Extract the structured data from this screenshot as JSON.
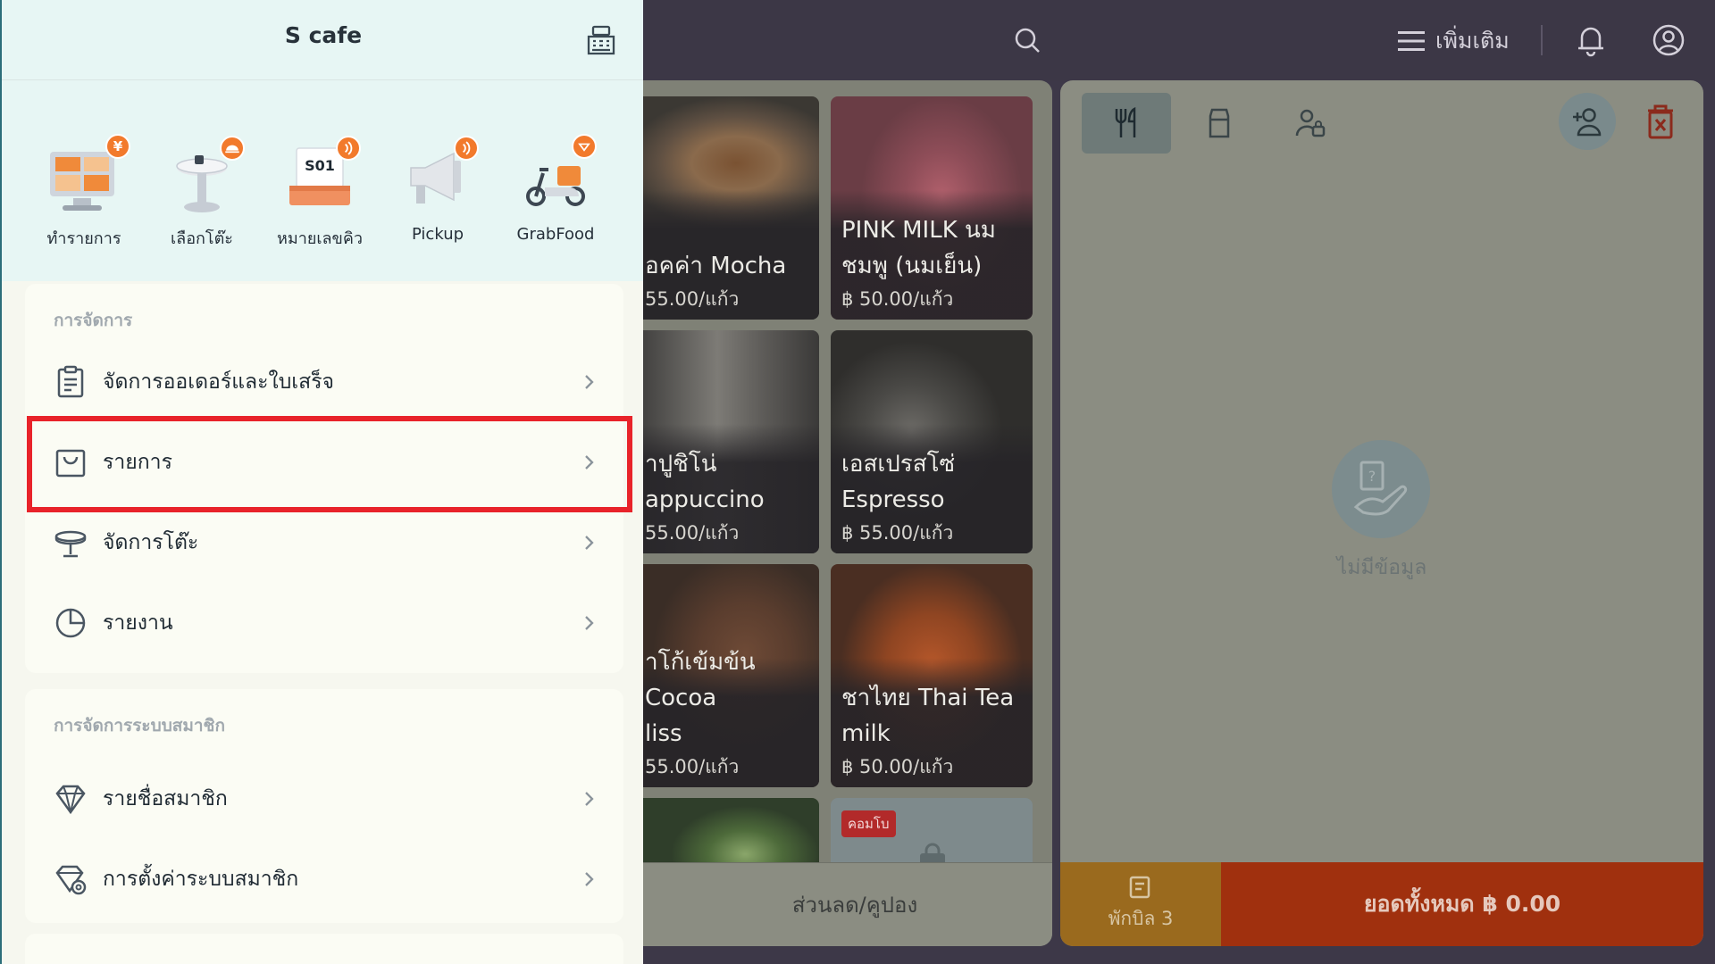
{
  "topbar": {
    "more_label": "เพิ่มเติม"
  },
  "drawer": {
    "title": "S cafe",
    "quick_actions": [
      {
        "label": "ทำรายการ",
        "badge": "¥"
      },
      {
        "label": "เลือกโต๊ะ"
      },
      {
        "label": "หมายเลขคิว",
        "code": "S01"
      },
      {
        "label": "Pickup"
      },
      {
        "label": "GrabFood"
      }
    ],
    "management": {
      "title": "การจัดการ",
      "items": [
        {
          "label": "จัดการออเดอร์และใบเสร็จ"
        },
        {
          "label": "รายการ"
        },
        {
          "label": "จัดการโต๊ะ"
        },
        {
          "label": "รายงาน"
        }
      ]
    },
    "membership": {
      "title": "การจัดการระบบสมาชิก",
      "items": [
        {
          "label": "รายชื่อสมาชิก"
        },
        {
          "label": "การตั้งค่าระบบสมาชิก"
        }
      ]
    }
  },
  "products": {
    "items": [
      {
        "name": "อคค่า Mocha",
        "price": "55.00/แก้ว"
      },
      {
        "name": "PINK MILK  นม\nชมพู (นมเย็น)",
        "price": "฿ 50.00/แก้ว"
      },
      {
        "name": "าปูชิโน่\nappuccino",
        "price": "55.00/แก้ว"
      },
      {
        "name": "เอสเปรสโซ่\nEspresso",
        "price": "฿ 55.00/แก้ว"
      },
      {
        "name": "าโก้เข้มข้น Cocoa\nliss",
        "price": "55.00/แก้ว"
      },
      {
        "name": "ชาไทย  Thai Tea\nmilk",
        "price": "฿ 50.00/แก้ว"
      }
    ],
    "combo_tag": "คอมโบ",
    "discount_label": "ส่วนลด/คูปอง"
  },
  "order": {
    "empty_text": "ไม่มีข้อมูล",
    "park_label": "พักบิล 3",
    "total_label": "ยอดทั้งหมด ฿ 0.00"
  },
  "colors": {
    "accent_highlight": "#e8232a",
    "badge_orange": "#f27a2c",
    "total_button": "#a0300e",
    "park_button": "#9a6a1e"
  }
}
